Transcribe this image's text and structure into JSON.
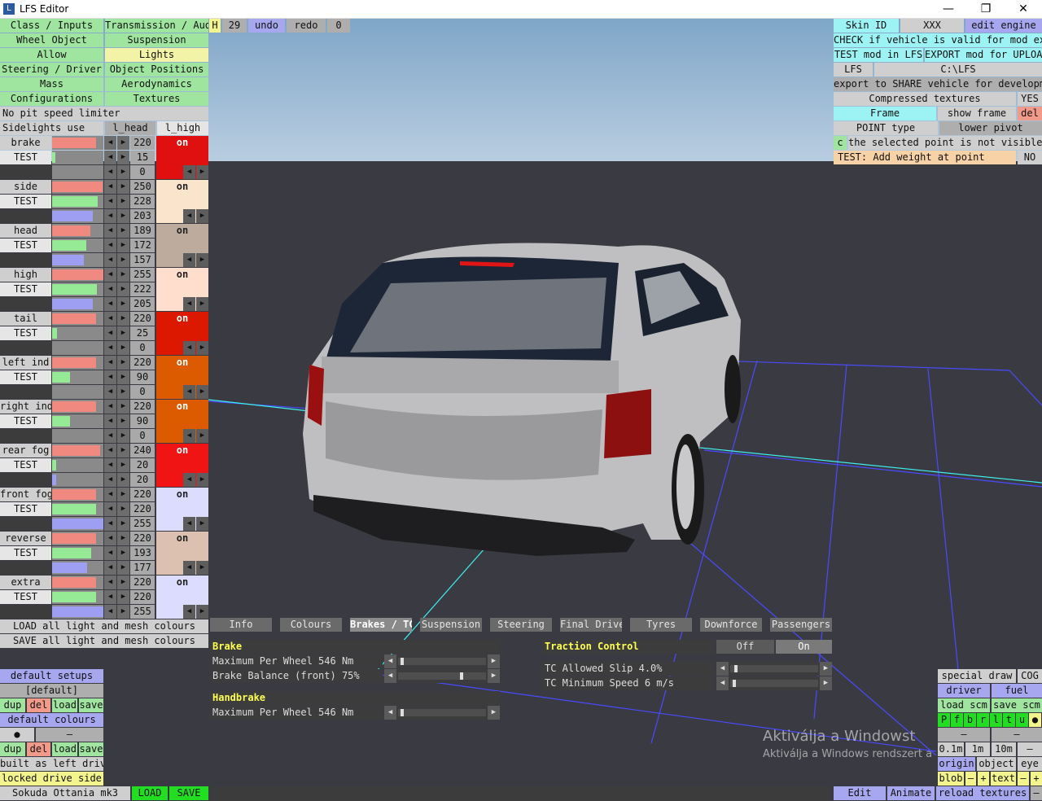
{
  "window": {
    "title": "LFS Editor",
    "minimize": "—",
    "maximize": "❐",
    "close": "✕"
  },
  "top_tabs": {
    "class_inputs": "Class / Inputs",
    "transmission_audio": "Transmission / Audio",
    "wheel_object": "Wheel Object",
    "suspension": "Suspension",
    "allow": "Allow",
    "lights": "Lights",
    "steering_driver": "Steering / Driver",
    "object_positions": "Object Positions",
    "mass": "Mass",
    "aerodynamics": "Aerodynamics",
    "configurations": "Configurations",
    "textures": "Textures"
  },
  "toolbar": {
    "h": "H",
    "count": "29",
    "undo": "undo",
    "redo": "redo",
    "zero": "0"
  },
  "lights": {
    "pit_limiter": "No pit speed limiter",
    "sidelights": "Sidelights use",
    "col_head": "l_head",
    "col_high": "l_high",
    "test": "TEST",
    "on": "on",
    "rows": [
      {
        "name": "brake",
        "r": 220,
        "g": 15,
        "b": 0,
        "sw": "#e01010",
        "on_color": "#ffffff",
        "r_pct": 0.86,
        "g_pct": 0.06,
        "b_pct": 0
      },
      {
        "name": "side",
        "r": 250,
        "g": 228,
        "b": 203,
        "sw": "#fae4cb",
        "on_color": "#222222",
        "r_pct": 0.98,
        "g_pct": 0.89,
        "b_pct": 0.8
      },
      {
        "name": "head",
        "r": 189,
        "g": 172,
        "b": 157,
        "sw": "#bdac9d",
        "on_color": "#222222",
        "r_pct": 0.74,
        "g_pct": 0.67,
        "b_pct": 0.62
      },
      {
        "name": "high",
        "r": 255,
        "g": 222,
        "b": 205,
        "sw": "#ffdecd",
        "on_color": "#222222",
        "r_pct": 1,
        "g_pct": 0.87,
        "b_pct": 0.8
      },
      {
        "name": "tail",
        "r": 220,
        "g": 25,
        "b": 0,
        "sw": "#dc1900",
        "on_color": "#ffffff",
        "r_pct": 0.86,
        "g_pct": 0.1,
        "b_pct": 0
      },
      {
        "name": "left ind",
        "r": 220,
        "g": 90,
        "b": 0,
        "sw": "#dc5a00",
        "on_color": "#ffffff",
        "r_pct": 0.86,
        "g_pct": 0.35,
        "b_pct": 0
      },
      {
        "name": "right ind",
        "r": 220,
        "g": 90,
        "b": 0,
        "sw": "#dc5a00",
        "on_color": "#ffffff",
        "r_pct": 0.86,
        "g_pct": 0.35,
        "b_pct": 0
      },
      {
        "name": "rear fog",
        "r": 240,
        "g": 20,
        "b": 20,
        "sw": "#f01414",
        "on_color": "#ffffff",
        "r_pct": 0.94,
        "g_pct": 0.08,
        "b_pct": 0.08
      },
      {
        "name": "front fog",
        "r": 220,
        "g": 220,
        "b": 255,
        "sw": "#dcdcff",
        "on_color": "#222222",
        "r_pct": 0.86,
        "g_pct": 0.86,
        "b_pct": 1
      },
      {
        "name": "reverse",
        "r": 220,
        "g": 193,
        "b": 177,
        "sw": "#dcc1b1",
        "on_color": "#222222",
        "r_pct": 0.86,
        "g_pct": 0.76,
        "b_pct": 0.69
      },
      {
        "name": "extra",
        "r": 220,
        "g": 220,
        "b": 255,
        "sw": "#dcdcff",
        "on_color": "#222222",
        "r_pct": 0.86,
        "g_pct": 0.86,
        "b_pct": 1
      }
    ],
    "load_all": "LOAD all light and mesh colours",
    "save_all": "SAVE all light and mesh colours"
  },
  "setups": {
    "default_setups": "default setups",
    "default": "[default]",
    "dup": "dup",
    "del": "del",
    "load": "load",
    "save": "save",
    "default_colours": "default colours",
    "dot": "●",
    "dash": "–",
    "left_drive": "built as left drive",
    "locked_side": "locked drive side",
    "car_name": "Sokuda Ottania mk3",
    "load_btn": "LOAD",
    "save_btn": "SAVE"
  },
  "right": {
    "skin_id": "Skin ID",
    "xxx": "XXX",
    "edit_engine": "edit engine",
    "check": "CHECK if vehicle is valid for mod export",
    "test_mod": "TEST mod in LFS",
    "export_mod": "EXPORT mod for UPLOAD",
    "lfs": "LFS",
    "path": "C:\\LFS",
    "export_share": "export to SHARE vehicle for development",
    "compressed": "Compressed textures",
    "yes": "YES",
    "frame": "Frame",
    "show_frame": "show frame",
    "del": "del",
    "point_type": "POINT type",
    "lower_pivot": "lower pivot",
    "c": "c",
    "not_visible": "the selected point is not visible",
    "test_weight": "TEST: Add weight at point",
    "no": "NO"
  },
  "bottom_tabs": [
    "Info",
    "Colours",
    "Brakes / TC",
    "Suspension",
    "Steering",
    "Final Drive",
    "Tyres",
    "Downforce",
    "Passengers"
  ],
  "brakes": {
    "brake": "Brake",
    "max_wheel": "Maximum Per Wheel 546 Nm",
    "max_wheel_frac": 0.02,
    "balance": "Brake Balance (front) 75%",
    "balance_frac": 0.75,
    "handbrake": "Handbrake",
    "hb_max": "Maximum Per Wheel 546 Nm",
    "hb_frac": 0.02,
    "tc": "Traction Control",
    "off": "Off",
    "on": "On",
    "slip": "TC Allowed Slip 4.0%",
    "slip_frac": 0.04,
    "min_speed": "TC Minimum Speed 6 m/s",
    "speed_frac": 0.02
  },
  "br": {
    "special_draw": "special draw",
    "cog": "COG",
    "driver": "driver",
    "fuel": "fuel",
    "load_scm": "load scm",
    "save_scm": "save scm",
    "letters": [
      "P",
      "f",
      "b",
      "r",
      "l",
      "t",
      "u",
      "●"
    ],
    "dash": "–",
    "s01": "0.1m",
    "s1": "1m",
    "s10": "10m",
    "origin": "origin",
    "object": "object",
    "eye": "eye",
    "blob": "blob",
    "minus": "–",
    "plus": "+",
    "text": "text",
    "edit": "Edit",
    "animate": "Animate",
    "reload": "reload textures"
  },
  "watermark": {
    "line1": "Aktiválja a Windowst",
    "line2": "Aktiválja a Windows rendszert a"
  }
}
